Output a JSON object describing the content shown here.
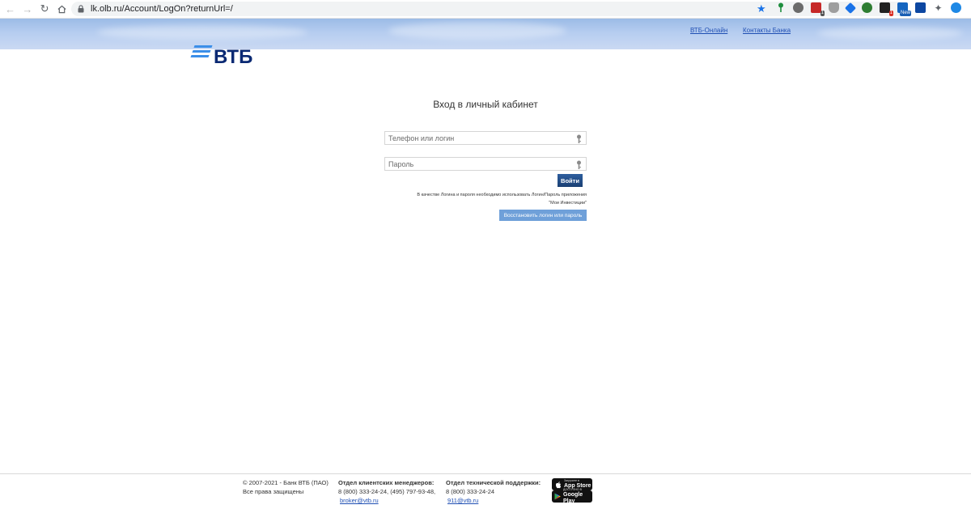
{
  "browser": {
    "url": "lk.olb.ru/Account/LogOn?returnUrl=/",
    "extension_badges": [
      "1",
      "1",
      "New"
    ]
  },
  "header": {
    "links": [
      "ВТБ-Онлайн",
      "Контакты Банка"
    ]
  },
  "logo": {
    "text": "ВТБ",
    "color": "#0a2973",
    "stripe_color": "#3b8ee8"
  },
  "login": {
    "title": "Вход в личный кабинет",
    "login_placeholder": "Телефон или логин",
    "password_placeholder": "Пароль",
    "submit_label": "Войти",
    "note_line1": "В качестве Логина и пароля необходимо использовать Логин/Пароль приложения",
    "note_line2": "\"Мои Инвестиции\"",
    "restore_label": "Восстановить логин или пароль"
  },
  "footer": {
    "copyright": "© 2007-2021 - Банк ВТБ (ПАО)",
    "rights": "Все права защищены",
    "managers_head": "Отдел клиентских менеджеров:",
    "managers_phones": "8 (800) 333-24-24, (495) 797-93-48,",
    "managers_email": "broker@vtb.ru",
    "support_head": "Отдел технической поддержки:",
    "support_phone": "8 (800) 333-24-24",
    "support_email": "911@vtb.ru",
    "appstore_small": "Загрузите в",
    "appstore_big": "App Store",
    "googleplay_small": "ДОСТУПНО В",
    "googleplay_big": "Google Play"
  }
}
